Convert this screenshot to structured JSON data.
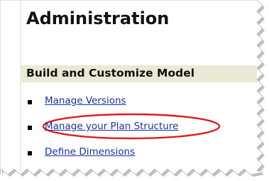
{
  "page": {
    "title": "Administration"
  },
  "section": {
    "title": "Build and Customize Model",
    "links": [
      {
        "label": "Manage Versions"
      },
      {
        "label": "Manage your Plan Structure",
        "highlighted": true
      },
      {
        "label": "Define Dimensions"
      }
    ]
  },
  "colors": {
    "section_band": "#e9e9d6",
    "link": "#1b32a0",
    "highlight_ellipse": "#e01b1b",
    "torn_edge_shadow": "#8a8a8a"
  }
}
